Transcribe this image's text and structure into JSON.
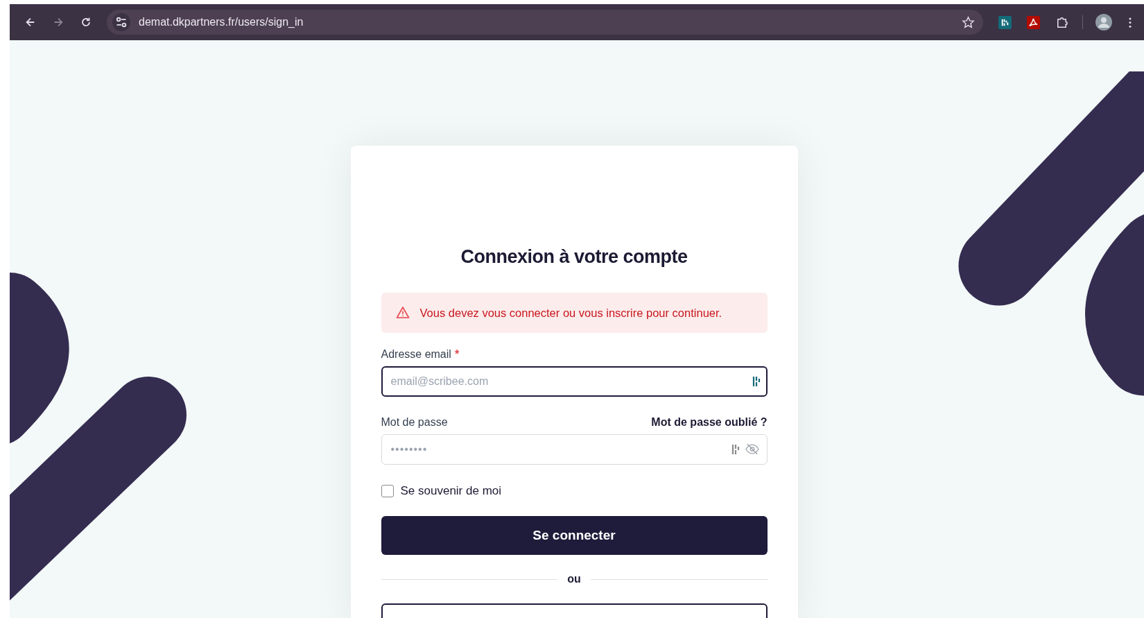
{
  "browser": {
    "url": "demat.dkpartners.fr/users/sign_in"
  },
  "login": {
    "title": "Connexion à votre compte",
    "alert": "Vous devez vous connecter ou vous inscrire pour continuer.",
    "email": {
      "label": "Adresse email",
      "required_mark": "*",
      "placeholder": "email@scribee.com",
      "focused": true
    },
    "password": {
      "label": "Mot de passe",
      "forgot_link": "Mot de passe oublié ?",
      "placeholder": "••••••••"
    },
    "remember": {
      "label": "Se souvenir de moi",
      "checked": false
    },
    "submit": "Se connecter",
    "divider": "ou"
  }
}
